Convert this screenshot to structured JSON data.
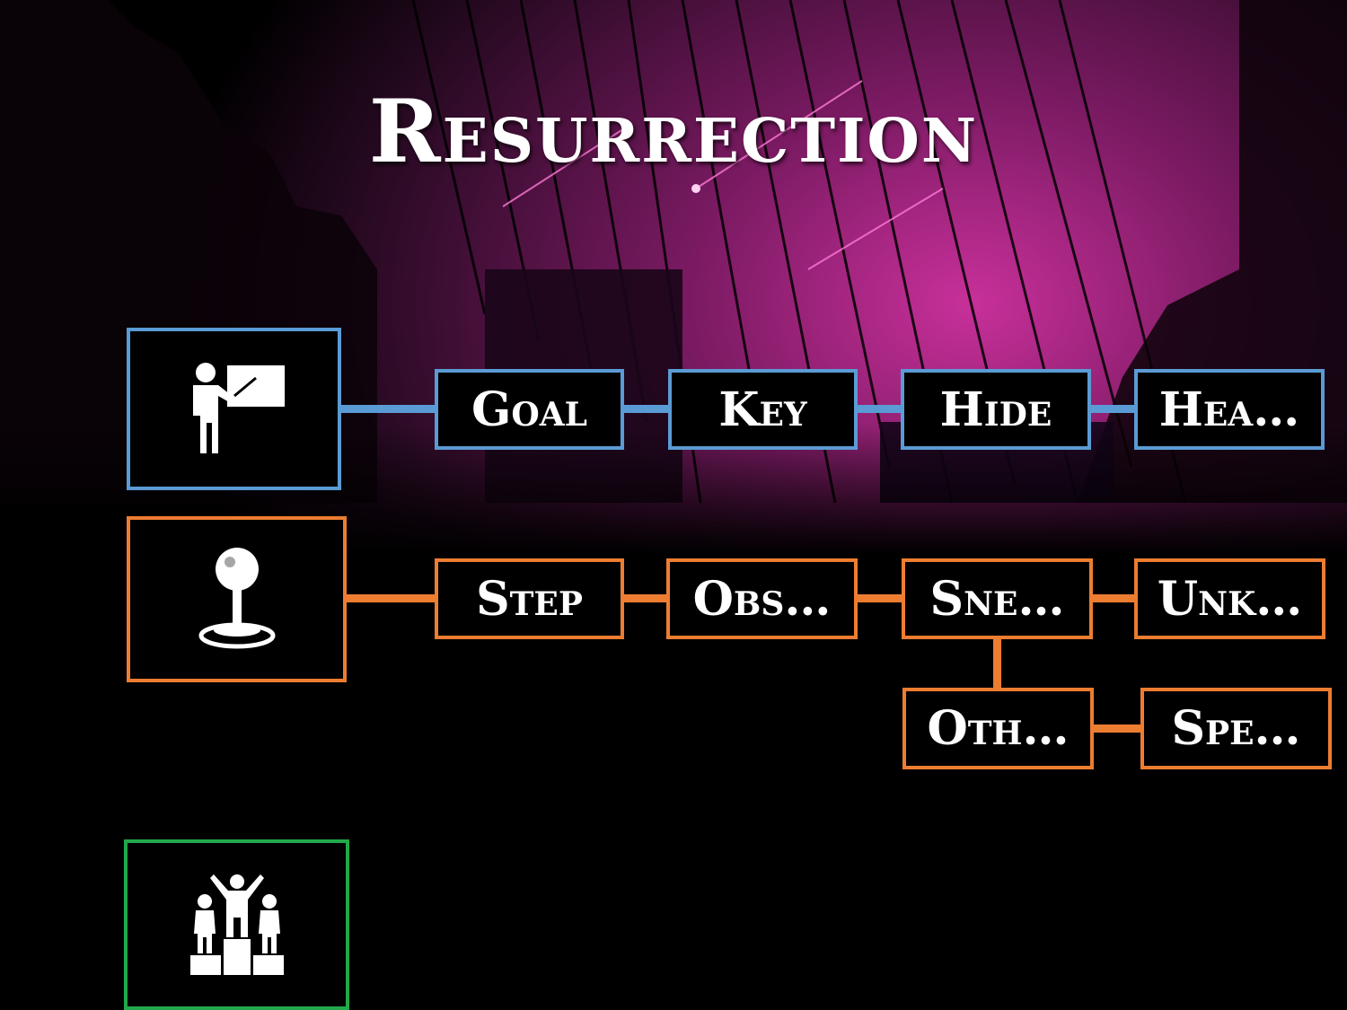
{
  "title": "Resurrection",
  "colors": {
    "blue": "#5b9bd5",
    "orange": "#ed7d31",
    "green": "#22a84b",
    "background_glow": "#c8309a"
  },
  "rows": {
    "teaching": {
      "icon": "teacher-icon",
      "nodes": [
        "Goal",
        "Key",
        "Hide",
        "Hea…"
      ]
    },
    "gameplay": {
      "icon": "joystick-icon",
      "nodes": [
        "Step",
        "Obs…",
        "Sne…",
        "Unk…"
      ],
      "branch": [
        "Oth…",
        "Spe…"
      ]
    },
    "players": {
      "icon": "podium-icon"
    }
  }
}
